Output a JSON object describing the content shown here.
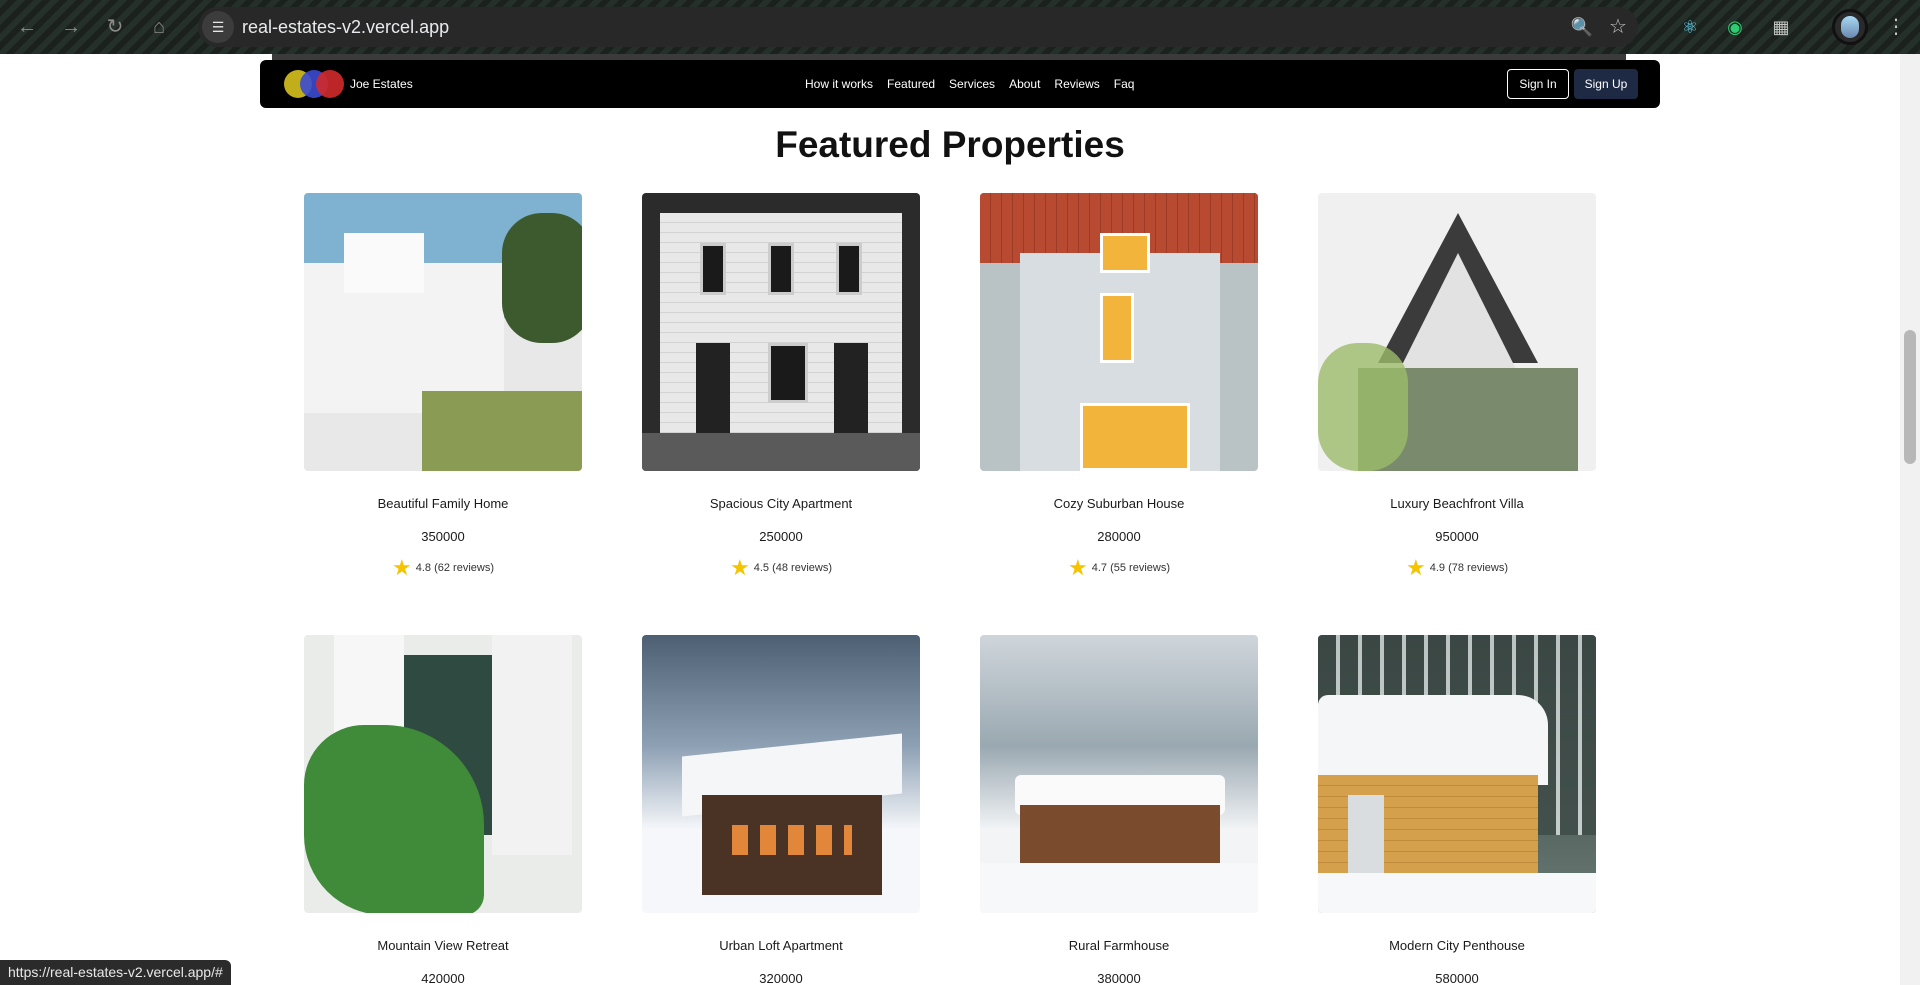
{
  "browser": {
    "url": "real-estates-v2.vercel.app",
    "status_url": "https://real-estates-v2.vercel.app/#"
  },
  "navbar": {
    "brand": "Joe Estates",
    "links": [
      "How it works",
      "Featured",
      "Services",
      "About",
      "Reviews",
      "Faq"
    ],
    "sign_in": "Sign In",
    "sign_up": "Sign Up"
  },
  "section": {
    "title": "Featured Properties"
  },
  "properties": [
    {
      "name": "Beautiful Family Home",
      "price": "350000",
      "rating": "4.8 (62 reviews)"
    },
    {
      "name": "Spacious City Apartment",
      "price": "250000",
      "rating": "4.5 (48 reviews)"
    },
    {
      "name": "Cozy Suburban House",
      "price": "280000",
      "rating": "4.7 (55 reviews)"
    },
    {
      "name": "Luxury Beachfront Villa",
      "price": "950000",
      "rating": "4.9 (78 reviews)"
    },
    {
      "name": "Mountain View Retreat",
      "price": "420000",
      "rating": ""
    },
    {
      "name": "Urban Loft Apartment",
      "price": "320000",
      "rating": ""
    },
    {
      "name": "Rural Farmhouse",
      "price": "380000",
      "rating": ""
    },
    {
      "name": "Modern City Penthouse",
      "price": "580000",
      "rating": ""
    }
  ],
  "colors": {
    "navbar_bg": "#000000",
    "star": "#f5c400",
    "signup_bg": "#1e2a44"
  }
}
